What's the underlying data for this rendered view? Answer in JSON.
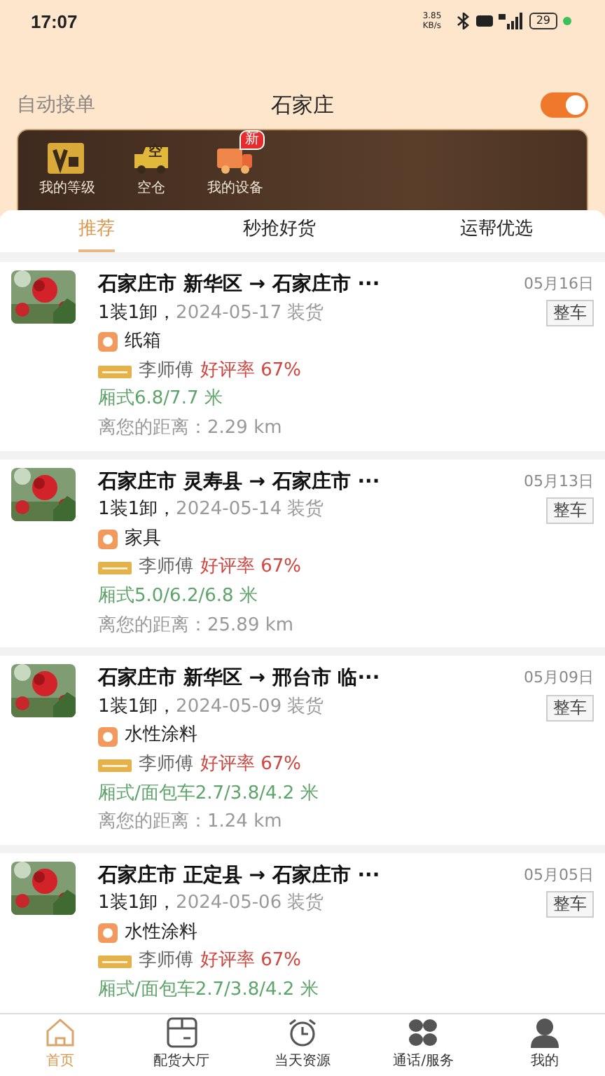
{
  "status_bar": {
    "time": "17:07",
    "speed": "3.85 KB/s",
    "battery": "29"
  },
  "header": {
    "auto_label": "自动接单",
    "city": "石家庄",
    "auto_on": true
  },
  "shortcuts": [
    {
      "label": "我的等级"
    },
    {
      "label": "空仓",
      "icon_text": "空"
    },
    {
      "label": "我的设备",
      "badge": "新"
    }
  ],
  "tabs": [
    {
      "label": "推荐",
      "selected": true
    },
    {
      "label": "秒抢好货",
      "selected": false
    },
    {
      "label": "运帮优选",
      "selected": false
    }
  ],
  "orders": [
    {
      "route": "石家庄市 新华区 → 石家庄市 ···",
      "date": "05月16日",
      "tag": "整车",
      "load": "1装1卸，",
      "load_date": "2024-05-17 装货",
      "cargo": "纸箱",
      "driver": "李师傅",
      "rating": "好评率 67%",
      "truck": "厢式6.8/7.7 米",
      "distance": "离您的距离：2.29 km"
    },
    {
      "route": "石家庄市 灵寿县 → 石家庄市 ···",
      "date": "05月13日",
      "tag": "整车",
      "load": "1装1卸，",
      "load_date": "2024-05-14 装货",
      "cargo": "家具",
      "driver": "李师傅",
      "rating": "好评率 67%",
      "truck": "厢式5.0/6.2/6.8 米",
      "distance": "离您的距离：25.89 km"
    },
    {
      "route": "石家庄市 新华区 → 邢台市 临···",
      "date": "05月09日",
      "tag": "整车",
      "load": "1装1卸，",
      "load_date": "2024-05-09 装货",
      "cargo": "水性涂料",
      "driver": "李师傅",
      "rating": "好评率 67%",
      "truck": "厢式/面包车2.7/3.8/4.2 米",
      "distance": "离您的距离：1.24 km"
    },
    {
      "route": "石家庄市 正定县 → 石家庄市 ···",
      "date": "05月05日",
      "tag": "整车",
      "load": "1装1卸，",
      "load_date": "2024-05-06 装货",
      "cargo": "水性涂料",
      "driver": "李师傅",
      "rating": "好评率 67%",
      "truck": "厢式/面包车2.7/3.8/4.2 米"
    }
  ],
  "bottom_nav": [
    {
      "label": "首页",
      "selected": true
    },
    {
      "label": "配货大厅",
      "selected": false
    },
    {
      "label": "当天资源",
      "selected": false
    },
    {
      "label": "通话/服务",
      "selected": false
    },
    {
      "label": "我的",
      "selected": false
    }
  ]
}
